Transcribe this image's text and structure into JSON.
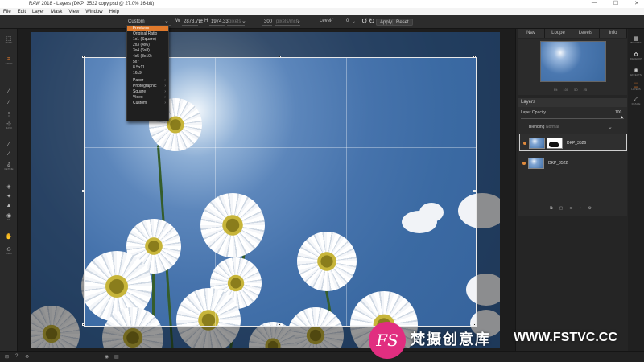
{
  "titlebar": {
    "title": "RAW 2018 - Layers (DKP_3522 copy.psd @ 27.0% 16-bit)",
    "minimize": "—",
    "maximize": "☐",
    "close": "✕"
  },
  "menu": [
    "File",
    "Edit",
    "Layer",
    "Mask",
    "View",
    "Window",
    "Help"
  ],
  "options": {
    "preset": "Custom",
    "width_label": "W",
    "width": "2873.79",
    "swap_icon": "⇄",
    "height_label": "H",
    "height": "1974.33",
    "units": "pixels",
    "resolution": "300",
    "res_units": "pixels/inch",
    "level_label": "Level",
    "level_value": "0",
    "apply": "Apply",
    "reset": "Reset"
  },
  "dropdown": {
    "items": [
      {
        "label": "Freeform",
        "active": true,
        "submenu": false
      },
      {
        "label": "Original Ratio",
        "submenu": false
      },
      {
        "label": "1x1 (Square)",
        "submenu": false
      },
      {
        "label": "2x3 (4x6)",
        "submenu": false
      },
      {
        "label": "3x4 (6x8)",
        "submenu": false
      },
      {
        "label": "4x5 (8x10)",
        "submenu": false
      },
      {
        "label": "5x7",
        "submenu": false
      },
      {
        "label": "8.5x11",
        "submenu": false
      },
      {
        "label": "16x9",
        "submenu": false
      },
      {
        "sep": true
      },
      {
        "label": "Paper",
        "submenu": true
      },
      {
        "label": "Photographic",
        "submenu": true
      },
      {
        "label": "Square",
        "submenu": true
      },
      {
        "label": "Video",
        "submenu": true
      },
      {
        "label": "Custom",
        "submenu": true
      }
    ]
  },
  "lefttools": [
    {
      "icon": "move-icon",
      "glyph": "⬚",
      "label": "MOVE"
    },
    {
      "icon": "crop-icon",
      "glyph": "⌗",
      "label": "CROP",
      "active": true
    },
    {
      "icon": "brush-icon",
      "glyph": "∕",
      "label": ""
    },
    {
      "icon": "brush2-icon",
      "glyph": "∕",
      "label": ""
    },
    {
      "icon": "adjust-icon",
      "glyph": "⋮",
      "label": ""
    },
    {
      "icon": "mask-brush-icon",
      "glyph": "⊹",
      "label": "MASK"
    },
    {
      "icon": "retouch-brush-icon",
      "glyph": "∕",
      "label": ""
    },
    {
      "icon": "clone-icon",
      "glyph": "∕",
      "label": ""
    },
    {
      "icon": "heal-icon",
      "glyph": "∂",
      "label": "RETINE"
    },
    {
      "icon": "fill-icon",
      "glyph": "◈",
      "label": ""
    },
    {
      "icon": "dropper-icon",
      "glyph": "✦",
      "label": ""
    },
    {
      "icon": "stamp-icon",
      "glyph": "▲",
      "label": ""
    },
    {
      "icon": "eye-icon",
      "glyph": "◉",
      "label": "FX"
    },
    {
      "icon": "hand-icon",
      "glyph": "✋",
      "label": ""
    },
    {
      "icon": "zoom-icon",
      "glyph": "⊙",
      "label": "VIEW"
    }
  ],
  "rightpanel": {
    "tabs": [
      "Nav",
      "Loupe",
      "Levels",
      "Info"
    ],
    "zooms": [
      "Fit",
      "100",
      "50",
      "25"
    ],
    "layers_title": "Layers",
    "opacity_label": "Layer Opacity",
    "opacity_value": "100",
    "blending_label": "Blending",
    "blending_value": "Normal",
    "layers": [
      {
        "name": "DKP_3526",
        "has_mask": true
      },
      {
        "name": "DKP_3522",
        "has_mask": false
      }
    ]
  },
  "modules": [
    {
      "icon": "browse-icon",
      "glyph": "▦",
      "label": "BROWSE"
    },
    {
      "icon": "develop-icon",
      "glyph": "✿",
      "label": "DEVELOP"
    },
    {
      "icon": "effects-icon",
      "glyph": "✺",
      "label": "EFFECTS"
    },
    {
      "icon": "layers-icon",
      "glyph": "❏",
      "label": "LAYERS",
      "active": true
    },
    {
      "icon": "resize-icon",
      "glyph": "⤢",
      "label": "RESIZE"
    }
  ],
  "watermark": {
    "logo": "FS",
    "name": "梵摄创意库",
    "url": "WWW.FSTVC.CC"
  },
  "colors": {
    "accent": "#e07a2c",
    "watermark_pink": "#e12e80"
  }
}
